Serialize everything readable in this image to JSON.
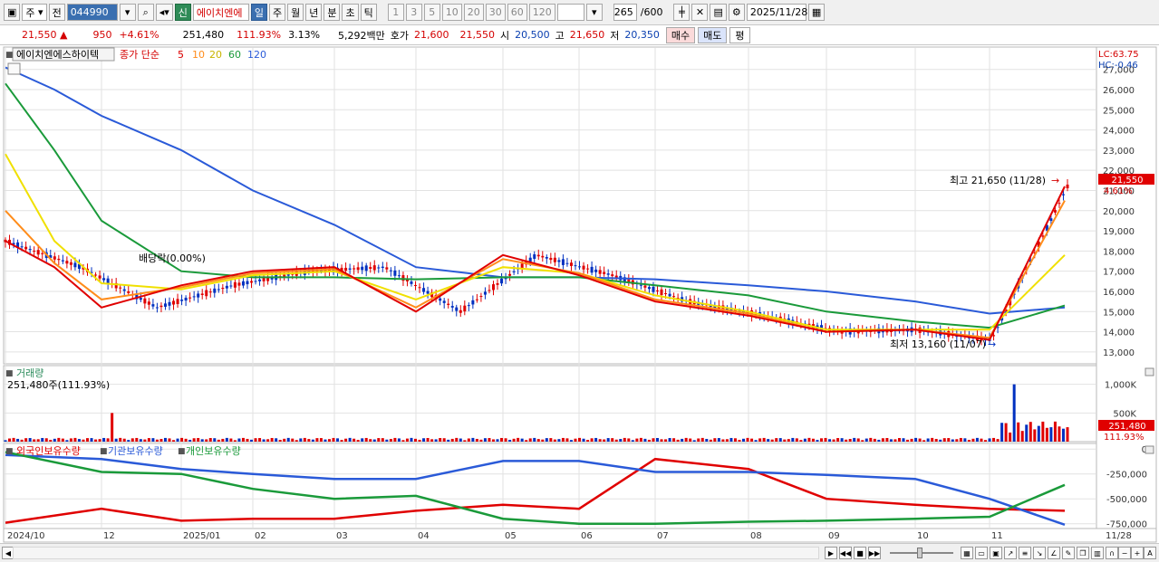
{
  "toolbar": {
    "market": "주",
    "prev": "전",
    "code": "044990",
    "new_badge": "신",
    "stock_name": "에이치엔에",
    "periods": [
      "일",
      "주",
      "월",
      "년",
      "분",
      "초",
      "틱"
    ],
    "active_period": "일",
    "intervals": [
      "1",
      "3",
      "5",
      "10",
      "20",
      "30",
      "60",
      "120"
    ],
    "count": "265",
    "count_max": "/600",
    "date": "2025/11/28"
  },
  "quote": {
    "price": "21,550",
    "arrow": "▲",
    "change": "950",
    "change_pct": "+4.61%",
    "volume": "251,480",
    "volume_ratio": "111.93%",
    "turnover": "3.13%",
    "amount": "5,292백만",
    "ask_label": "호가",
    "ask": "21,600",
    "bid": "21,550",
    "open_label": "시",
    "open": "20,500",
    "high_label": "고",
    "high": "21,650",
    "low_label": "저",
    "low": "20,350",
    "buy_label": "매수",
    "sell_label": "매도",
    "eval_label": "평"
  },
  "price_panel": {
    "stock_label": "에이치엔에스하이텍",
    "ma_title": "종가 단순",
    "ma_periods": [
      "5",
      "10",
      "20",
      "60",
      "120"
    ],
    "ma_colors": [
      "#e00000",
      "#ff8c1a",
      "#f0e000",
      "#1a9a3a",
      "#2a5ad8"
    ],
    "lc": "LC:63.75",
    "hc": "HC:-0.46",
    "current_price_tag": "21,550",
    "current_pct_tag": "4.61%",
    "dividend_note": "배당락(0.00%)",
    "high_note": "최고 21,650 (11/28)",
    "low_note": "최저 13,160 (11/07)",
    "y_ticks": [
      "27,000",
      "26,000",
      "25,000",
      "24,000",
      "23,000",
      "22,000",
      "21,000",
      "20,000",
      "19,000",
      "18,000",
      "17,000",
      "16,000",
      "15,000",
      "14,000",
      "13,000"
    ],
    "colors": {
      "up": "#e00000",
      "down": "#0030c0",
      "grid": "#d8d8d8"
    }
  },
  "volume_panel": {
    "title": "거래량",
    "summary": "251,480주(111.93%)",
    "y_ticks": [
      "1,000K",
      "500K"
    ],
    "tag": "251,480",
    "tag_pct": "111.93%"
  },
  "holding_panel": {
    "series": [
      "외국인보유수량",
      "기관보유수량",
      "개인보유수량"
    ],
    "series_colors": [
      "#e00000",
      "#2a5ad8",
      "#1a9a3a"
    ],
    "y_ticks": [
      "0",
      "-250,000",
      "-500,000",
      "-750,000"
    ]
  },
  "x_axis": {
    "labels": [
      "2024/10",
      "12",
      "2025/01",
      "02",
      "03",
      "04",
      "05",
      "06",
      "07",
      "08",
      "09",
      "10",
      "11",
      "11/28"
    ]
  },
  "chart_data": [
    {
      "type": "line",
      "series": [
        {
          "name": "5",
          "x": [
            "2024/10",
            "2024/11",
            "2024/12",
            "2025/01",
            "2025/02",
            "2025/03",
            "2025/04",
            "2025/05",
            "2025/06",
            "2025/07",
            "2025/08",
            "2025/09",
            "2025/10",
            "2025/11",
            "2025/11/28"
          ],
          "values": [
            18500,
            17200,
            15200,
            16300,
            17000,
            17200,
            15000,
            17800,
            16800,
            15500,
            14800,
            14000,
            14100,
            13600,
            21200
          ]
        },
        {
          "name": "10",
          "x": [
            "2024/10",
            "2024/11",
            "2024/12",
            "2025/01",
            "2025/02",
            "2025/03",
            "2025/04",
            "2025/05",
            "2025/06",
            "2025/07",
            "2025/08",
            "2025/09",
            "2025/10",
            "2025/11",
            "2025/11/28"
          ],
          "values": [
            20000,
            17400,
            15600,
            16200,
            16900,
            17100,
            15200,
            17600,
            16900,
            15600,
            14900,
            14000,
            14100,
            13700,
            20500
          ]
        },
        {
          "name": "20",
          "x": [
            "2024/10",
            "2024/11",
            "2024/12",
            "2025/01",
            "2025/02",
            "2025/03",
            "2025/04",
            "2025/05",
            "2025/06",
            "2025/07",
            "2025/08",
            "2025/09",
            "2025/10",
            "2025/11",
            "2025/11/28"
          ],
          "values": [
            22800,
            18500,
            16400,
            16100,
            16800,
            17000,
            15600,
            17200,
            16900,
            15800,
            15000,
            14100,
            14100,
            14100,
            17800
          ]
        },
        {
          "name": "60",
          "x": [
            "2024/10",
            "2024/11",
            "2024/12",
            "2025/01",
            "2025/02",
            "2025/03",
            "2025/04",
            "2025/05",
            "2025/06",
            "2025/07",
            "2025/08",
            "2025/09",
            "2025/10",
            "2025/11",
            "2025/11/28"
          ],
          "values": [
            26300,
            23000,
            19500,
            17000,
            16700,
            16700,
            16600,
            16700,
            16700,
            16300,
            15800,
            15000,
            14500,
            14200,
            15300
          ]
        },
        {
          "name": "120",
          "x": [
            "2024/10",
            "2024/11",
            "2024/12",
            "2025/01",
            "2025/02",
            "2025/03",
            "2025/04",
            "2025/05",
            "2025/06",
            "2025/07",
            "2025/08",
            "2025/09",
            "2025/10",
            "2025/11",
            "2025/11/28"
          ],
          "values": [
            27100,
            26000,
            24700,
            23000,
            21000,
            19300,
            17200,
            16700,
            16700,
            16600,
            16300,
            16000,
            15500,
            14900,
            15200
          ]
        }
      ],
      "ylim": [
        12500,
        27300
      ]
    },
    {
      "type": "bar",
      "title": "거래량",
      "spike_labels": [
        "2024/12",
        "2025/11"
      ],
      "spike_values": [
        500000,
        1000000
      ],
      "last_value": 251480,
      "ylim": [
        0,
        1200000
      ]
    },
    {
      "type": "line",
      "series": [
        {
          "name": "외국인보유수량",
          "x": [
            "2024/10",
            "2024/12",
            "2025/01",
            "2025/02",
            "2025/03",
            "2025/04",
            "2025/05",
            "2025/06",
            "2025/07",
            "2025/08",
            "2025/09",
            "2025/10",
            "2025/11",
            "2025/11/28"
          ],
          "values": [
            -740000,
            -600000,
            -720000,
            -700000,
            -700000,
            -620000,
            -560000,
            -600000,
            -100000,
            -200000,
            -500000,
            -560000,
            -600000,
            -620000
          ]
        },
        {
          "name": "기관보유수량",
          "x": [
            "2024/10",
            "2024/12",
            "2025/01",
            "2025/02",
            "2025/03",
            "2025/04",
            "2025/05",
            "2025/06",
            "2025/07",
            "2025/08",
            "2025/09",
            "2025/10",
            "2025/11",
            "2025/11/28"
          ],
          "values": [
            -60000,
            -100000,
            -200000,
            -250000,
            -300000,
            -300000,
            -120000,
            -120000,
            -230000,
            -230000,
            -260000,
            -300000,
            -500000,
            -760000
          ]
        },
        {
          "name": "개인보유수량",
          "x": [
            "2024/10",
            "2024/12",
            "2025/01",
            "2025/02",
            "2025/03",
            "2025/04",
            "2025/05",
            "2025/06",
            "2025/07",
            "2025/08",
            "2025/09",
            "2025/10",
            "2025/11",
            "2025/11/28"
          ],
          "values": [
            -30000,
            -230000,
            -250000,
            -400000,
            -500000,
            -470000,
            -700000,
            -750000,
            -750000,
            -730000,
            -720000,
            -700000,
            -680000,
            -360000
          ]
        }
      ],
      "ylim": [
        -780000,
        20000
      ]
    }
  ]
}
